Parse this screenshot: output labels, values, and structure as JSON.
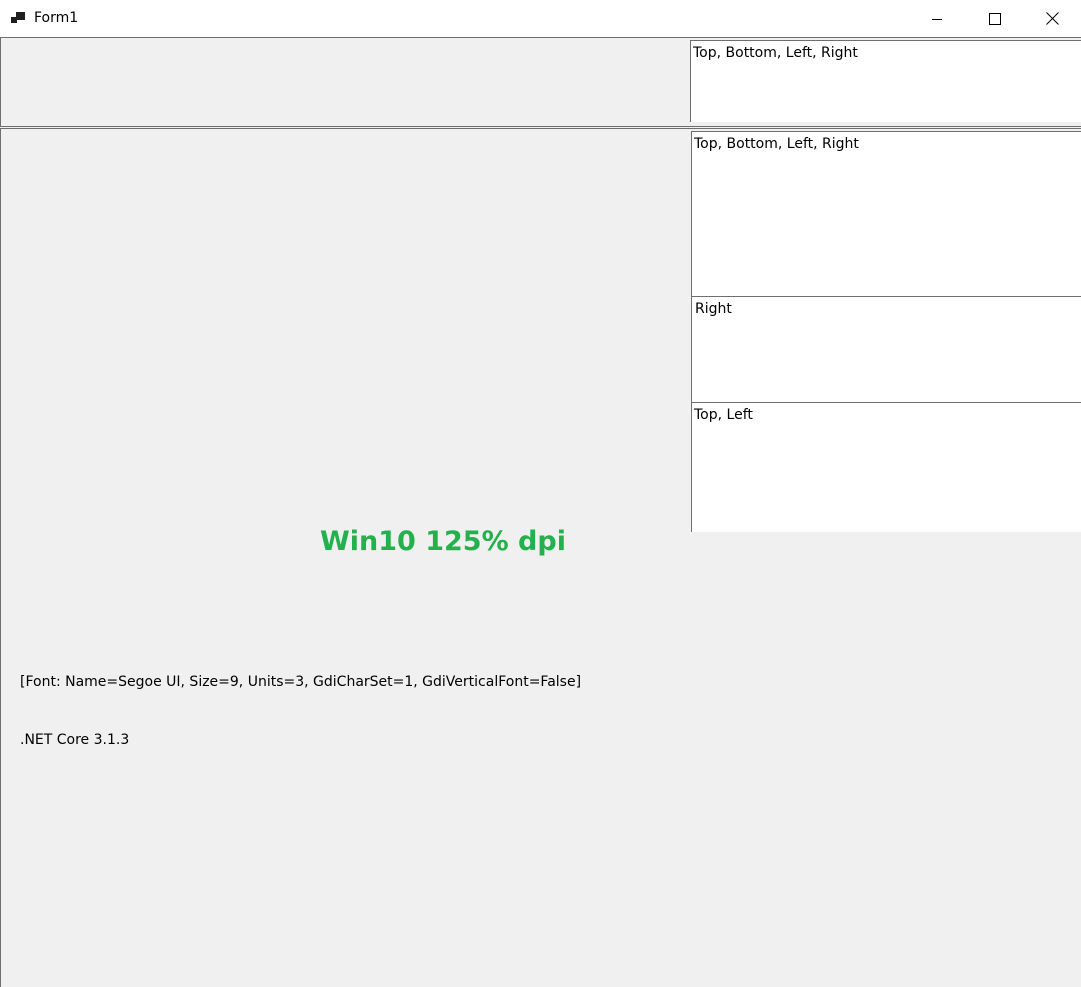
{
  "window": {
    "title": "Form1"
  },
  "caption_buttons": {
    "minimize_icon": "minimize-icon",
    "maximize_icon": "maximize-icon",
    "close_icon": "close-icon"
  },
  "top_panel": {
    "textbox": "Top, Bottom, Left, Right"
  },
  "main_panel": {
    "textboxes": [
      "Top, Bottom, Left, Right",
      "Right",
      "Top, Left"
    ],
    "dpi_label": "Win10 125% dpi",
    "font_label": "[Font: Name=Segoe UI, Size=9, Units=3, GdiCharSet=1, GdiVerticalFont=False]",
    "runtime_label": ".NET Core 3.1.3"
  },
  "colors": {
    "dpi_label": "#22b14c",
    "background": "#f0f0f0"
  }
}
